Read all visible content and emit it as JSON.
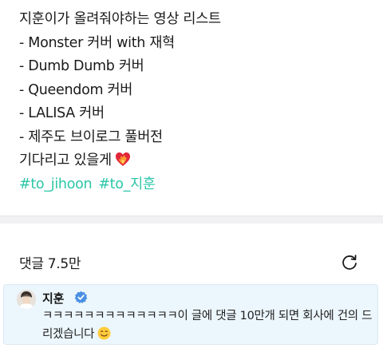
{
  "post": {
    "lines": [
      "지훈이가 올려줘야하는 영상 리스트",
      "- Monster 커버 with 재혁",
      "- Dumb Dumb 커버",
      "- Queendom 커버",
      "- LALISA 커버",
      "- 제주도 브이로그 풀버전",
      "기다리고 있을게"
    ],
    "hashtags": [
      "#to_jihoon",
      "#to_지훈"
    ]
  },
  "comments": {
    "count_label": "댓글 7.5만"
  },
  "pinned_comment": {
    "author": "지훈",
    "text": "ㅋㅋㅋㅋㅋㅋㅋㅋㅋㅋㅋㅋㅋ이 글에 댓글 10만개 되면 회사에 건의 드리겠습니다"
  },
  "colors": {
    "hashtag": "#2cc6a8",
    "pinned_bg": "#ecf6fd",
    "verified": "#4a90e2"
  },
  "icons": [
    "heart-on-fire-icon",
    "refresh-icon",
    "verified-badge-icon",
    "smiling-face-icon"
  ]
}
